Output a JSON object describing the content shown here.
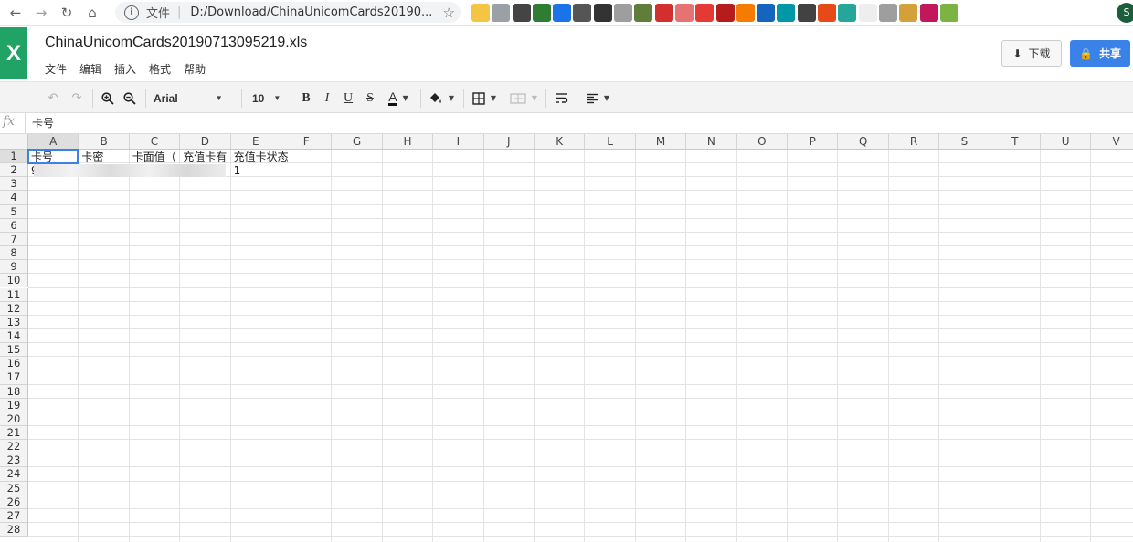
{
  "browser": {
    "scheme_label": "文件",
    "url": "D:/Download/ChinaUnicomCards20190...",
    "profile_initial": "S"
  },
  "extensions": [
    "#f4c542",
    "#9aa0a6",
    "#444",
    "#2e7d32",
    "#1a73e8",
    "#555",
    "#333",
    "#9e9e9e",
    "#607d3b",
    "#d32f2f",
    "#e57373",
    "#e53935",
    "#b71c1c",
    "#f57c00",
    "#1565c0",
    "#0097a7",
    "#424242",
    "#e64a19",
    "#26a69a",
    "#eeeeee",
    "#9e9e9e",
    "#d4a03a",
    "#c2185b",
    "#7cb342"
  ],
  "app": {
    "logo": "X",
    "title": "ChinaUnicomCards20190713095219.xls",
    "menu": [
      "文件",
      "编辑",
      "插入",
      "格式",
      "帮助"
    ],
    "download_label": "下载",
    "share_label": "共享"
  },
  "toolbar": {
    "font_name": "Arial",
    "font_size": "10"
  },
  "formula": {
    "fx": "fx",
    "value": "卡号"
  },
  "columns": [
    "A",
    "B",
    "C",
    "D",
    "E",
    "F",
    "G",
    "H",
    "I",
    "J",
    "K",
    "L",
    "M",
    "N",
    "O",
    "P",
    "Q",
    "R",
    "S",
    "T",
    "U",
    "V"
  ],
  "rows": [
    "1",
    "2",
    "3",
    "4",
    "5",
    "6",
    "7",
    "8",
    "9",
    "10",
    "11",
    "12",
    "13",
    "14",
    "15",
    "16",
    "17",
    "18",
    "19",
    "20",
    "21",
    "22",
    "23",
    "24",
    "25",
    "26",
    "27",
    "28"
  ],
  "cells": {
    "A1": "卡号",
    "B1": "卡密",
    "C1": "卡面值（",
    "D1": "充值卡有",
    "E1": "充值卡状态",
    "A2": "9",
    "E2": "1"
  },
  "colors": {
    "excel_green": "#21a366",
    "share_blue": "#3b82e8",
    "selection_blue": "#3b82e8"
  }
}
